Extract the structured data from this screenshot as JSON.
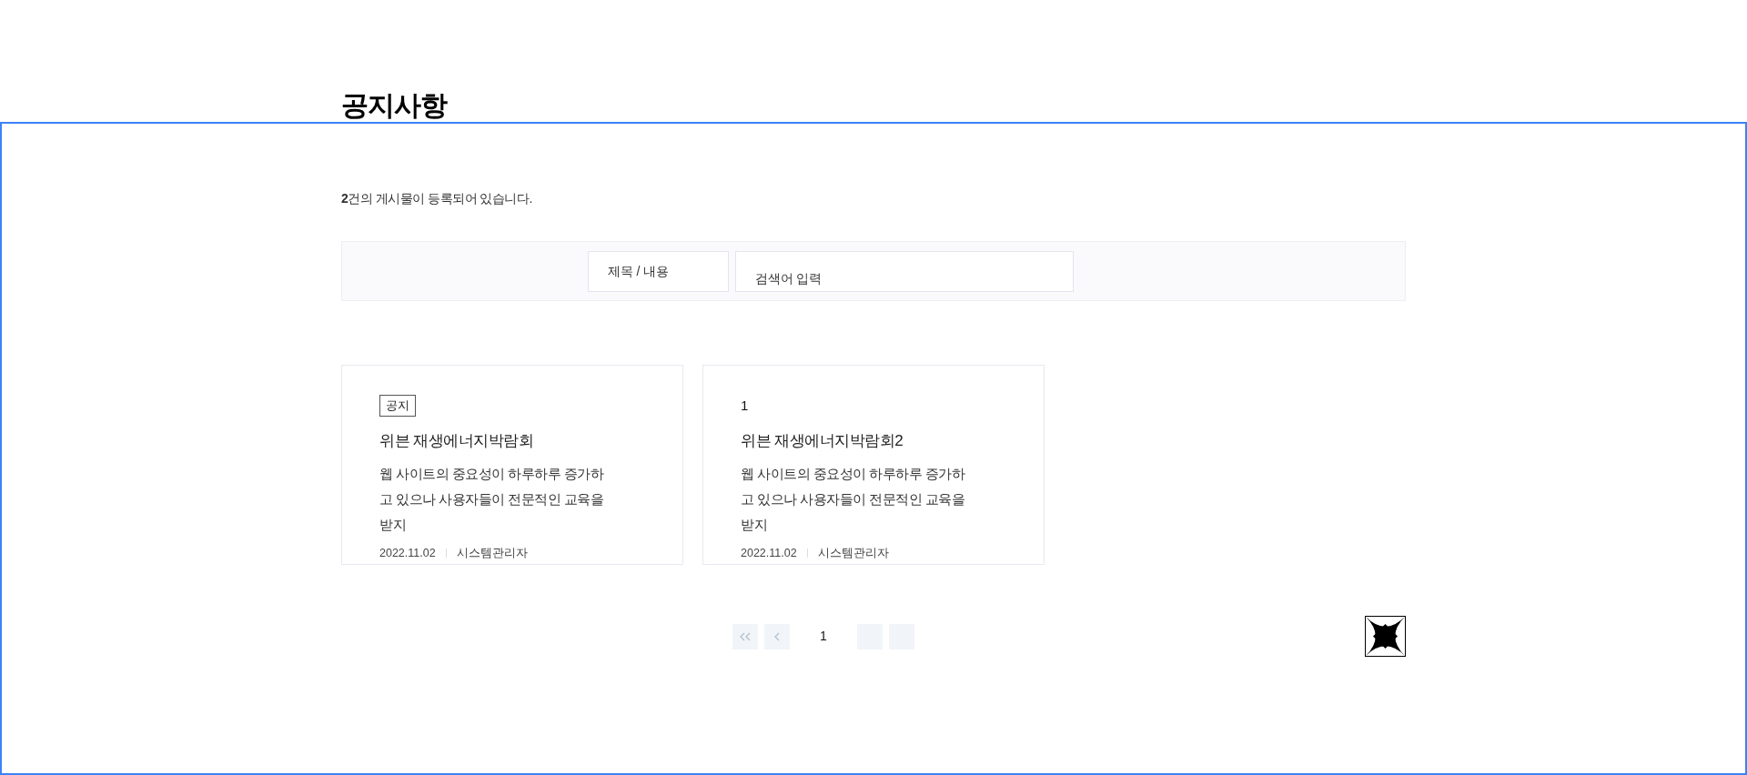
{
  "page_title": "공지사항",
  "count_text": "**2**건의 게시물이 등록되어 있습니다.",
  "search": {
    "category": "제목 / 내용",
    "placeholder": "검색어 입력"
  },
  "posts": [
    {
      "kind": "badge",
      "label": "공지",
      "title": "위븐 재생에너지박람회",
      "summary": "웹 사이트의 중요성이 하루하루 증가하고 있으나 사용자들이 전문적인 교육을 받지",
      "date": "2022.11.02",
      "author": "시스템관리자"
    },
    {
      "kind": "number",
      "label": "1",
      "title": "위븐 재생에너지박람회2",
      "summary": "웹 사이트의 중요성이 하루하루 증가하고 있으나 사용자들이 전문적인 교육을 받지",
      "date": "2022.11.02",
      "author": "시스템관리자"
    }
  ],
  "pagination": {
    "pages": [
      {
        "label": "1",
        "selected": true
      }
    ]
  }
}
